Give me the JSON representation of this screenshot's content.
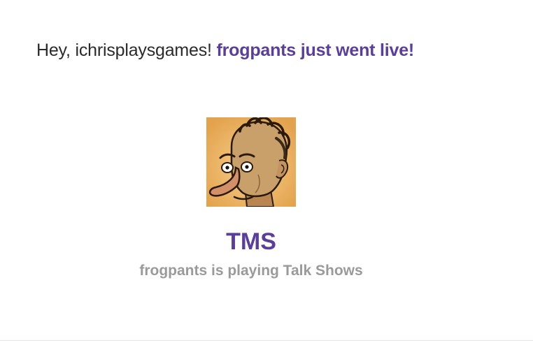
{
  "greeting": {
    "prefix": "Hey, ichrisplaysgames! ",
    "highlight": "frogpants just went live!"
  },
  "stream": {
    "avatar_icon": "caricature-avatar",
    "title": "TMS",
    "subtitle": "frogpants is playing Talk Shows"
  },
  "colors": {
    "accent": "#5a3e9c",
    "muted": "#9a9a9a",
    "text": "#2b2b2b"
  }
}
